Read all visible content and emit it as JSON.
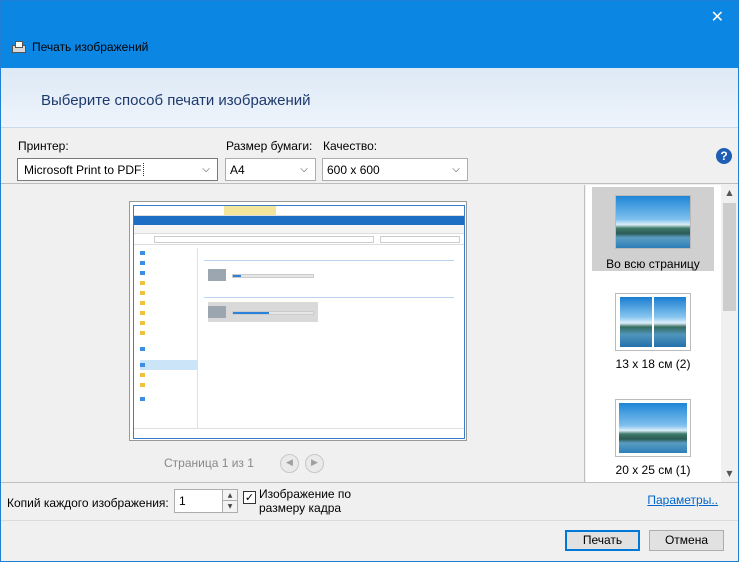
{
  "window": {
    "title": "Печать изображений",
    "close_glyph": "✕",
    "headline": "Выберите способ печати изображений"
  },
  "options": {
    "printer_label": "Принтер:",
    "printer_value": "Microsoft Print to PDF",
    "paper_label": "Размер бумаги:",
    "paper_value": "A4",
    "quality_label": "Качество:",
    "quality_value": "600 x 600",
    "help_glyph": "?"
  },
  "preview": {
    "page_indicator": "Страница 1 из 1",
    "prev_glyph": "◀",
    "next_glyph": "▶"
  },
  "layouts": [
    {
      "label": "Во всю страницу",
      "selected": true
    },
    {
      "label": "13 x 18 см (2)",
      "selected": false
    },
    {
      "label": "20 x 25 см (1)",
      "selected": false
    }
  ],
  "copies": {
    "label": "Копий каждого изображения:",
    "value": "1",
    "fit_label_line1": "Изображение по",
    "fit_label_line2": "размеру кадра",
    "fit_checked": true,
    "check_glyph": "✓",
    "params_link": "Параметры.."
  },
  "footer": {
    "print_label": "Печать",
    "cancel_label": "Отмена"
  },
  "icons": {
    "dropdown": "chevron-down-icon",
    "spin_up": "▲",
    "spin_down": "▼",
    "scroll_up": "▲",
    "scroll_down": "▼"
  },
  "colors": {
    "titlebar": "#0b86e3",
    "accent": "#0078d7",
    "headline": "#1e3a6d",
    "link": "#0066cc"
  }
}
